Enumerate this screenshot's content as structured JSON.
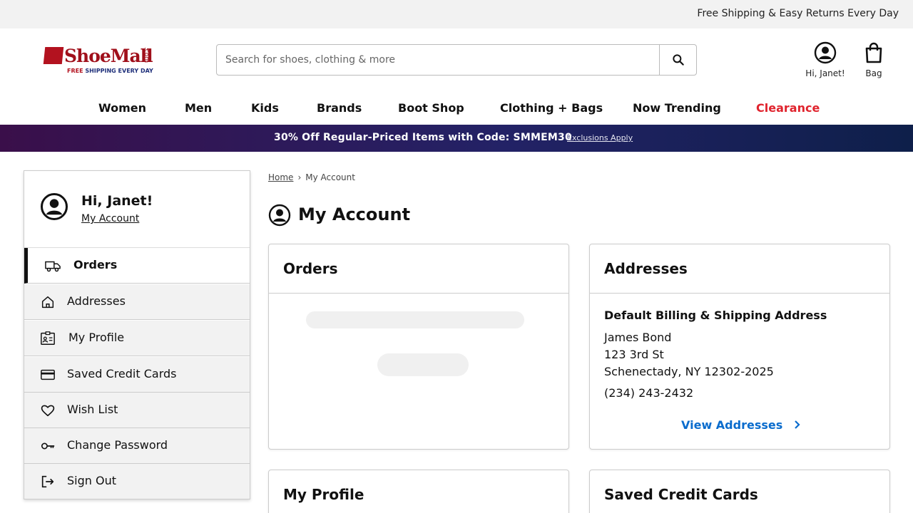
{
  "top_bar": {
    "promo_text": "Free Shipping & Easy Returns Every Day"
  },
  "logo": {
    "name": "ShoeMall",
    "com": ".com",
    "tag_free": "FREE",
    "tag_rest": " SHIPPING EVERY DAY"
  },
  "search": {
    "placeholder": "Search for shoes, clothing & more"
  },
  "header": {
    "account_label": "Hi, Janet!",
    "bag_label": "Bag"
  },
  "nav": {
    "items": [
      "Women",
      "Men",
      "Kids",
      "Brands",
      "Boot Shop",
      "Clothing + Bags",
      "Now Trending",
      "Clearance"
    ]
  },
  "banner": {
    "text": "30% Off Regular-Priced Items with Code: SMMEM30",
    "link": "Exclusions Apply"
  },
  "sidebar": {
    "greeting": "Hi, Janet!",
    "account_link": "My Account",
    "items": [
      {
        "label": "Orders",
        "icon": "truck-icon"
      },
      {
        "label": "Addresses",
        "icon": "home-icon"
      },
      {
        "label": "My Profile",
        "icon": "id-card-icon"
      },
      {
        "label": "Saved Credit Cards",
        "icon": "credit-card-icon"
      },
      {
        "label": "Wish List",
        "icon": "heart-icon"
      },
      {
        "label": "Change Password",
        "icon": "key-icon"
      },
      {
        "label": "Sign Out",
        "icon": "sign-out-icon"
      }
    ]
  },
  "breadcrumb": {
    "home": "Home",
    "current": "My Account"
  },
  "page": {
    "title": "My Account"
  },
  "cards": {
    "orders": {
      "title": "Orders"
    },
    "addresses": {
      "title": "Addresses",
      "subtitle": "Default Billing & Shipping Address",
      "name": "James Bond",
      "street": "123 3rd St",
      "city": "Schenectady, NY 12302-2025",
      "phone": "(234) 243-2432",
      "link": "View Addresses"
    },
    "profile": {
      "title": "My Profile"
    },
    "cards": {
      "title": "Saved Credit Cards"
    }
  },
  "colors": {
    "clearance": "#e0232d",
    "link": "#0a6ccd",
    "brand": "#a0101b"
  }
}
